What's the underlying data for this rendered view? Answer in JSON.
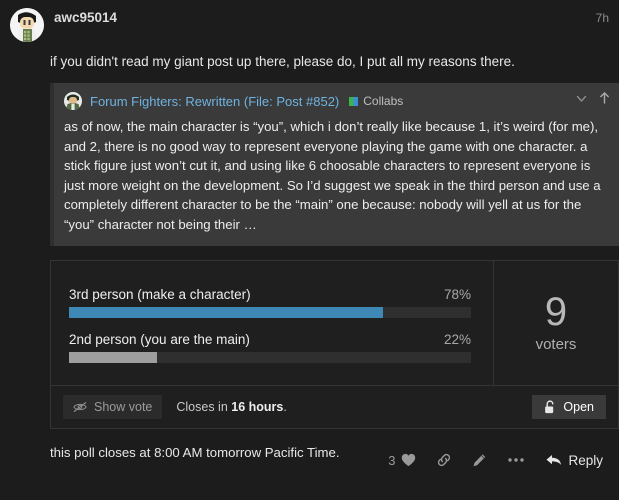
{
  "post": {
    "username": "awc95014",
    "timestamp": "7h",
    "avatar_icon": "user-avatar",
    "intro_text": "if you didn't read my giant post up there, please do, I put all my reasons there.",
    "closing_note": "this poll closes at 8:00 AM tomorrow Pacific Time."
  },
  "quote": {
    "avatar_icon": "quoted-user-avatar",
    "title": "Forum Fighters: Rewritten (File: Post #852)",
    "category": {
      "label": "Collabs",
      "color_left": "#39b54a",
      "color_right": "#3b8fd4"
    },
    "collapse_icon": "chevron-down-icon",
    "jump_icon": "arrow-up-icon",
    "body": "as of now, the main character is “you”, which i don’t really like because 1, it’s weird (for me), and 2, there is no good way to represent everyone playing the game with one character. a stick figure just won’t cut it, and using like 6 choosable characters to represent everyone is just more weight on the development. So I’d suggest we speak in the third person and use a completely different character to be the “main” one because: nobody will yell at us for the “you” character not being their …"
  },
  "poll": {
    "options": [
      {
        "label": "3rd person (make a character)",
        "percent_label": "78%",
        "percent_value": 78,
        "bar_color": "#3d88b5"
      },
      {
        "label": "2nd person (you are the main)",
        "percent_label": "22%",
        "percent_value": 22,
        "bar_color": "#9e9e9e"
      }
    ],
    "voters": {
      "count": "9",
      "label": "voters"
    },
    "footer": {
      "show_vote_label": "Show vote",
      "show_vote_icon": "eye-slash-icon",
      "closes_prefix": "Closes in ",
      "closes_value": "16 hours",
      "closes_suffix": ".",
      "open_label": "Open",
      "open_icon": "unlock-icon"
    }
  },
  "actions": {
    "like_count": "3",
    "like_icon": "heart-icon",
    "link_icon": "link-icon",
    "edit_icon": "pencil-icon",
    "more_icon": "ellipsis-icon",
    "reply_label": "Reply",
    "reply_icon": "reply-arrow-icon"
  }
}
